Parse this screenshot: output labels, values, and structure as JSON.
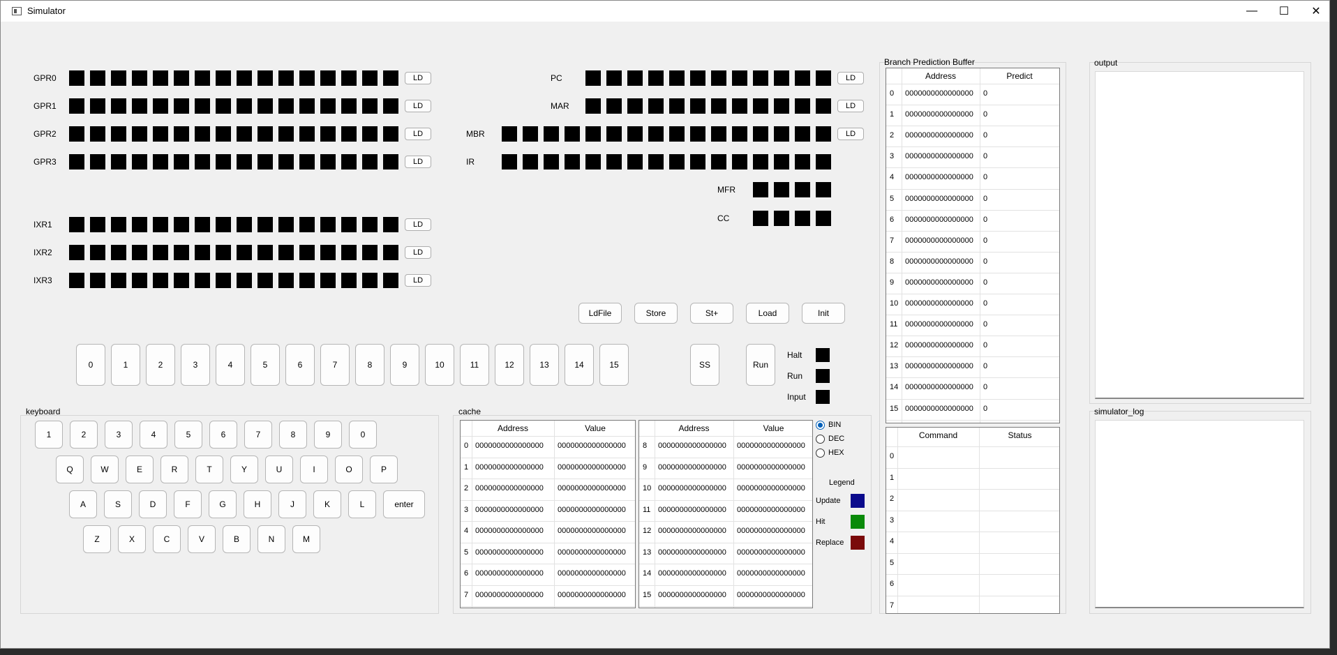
{
  "window": {
    "title": "Simulator",
    "minimize_glyph": "—",
    "maximize_glyph": "☐",
    "close_glyph": "✕",
    "icon": "app-window-icon"
  },
  "registers": {
    "gpr0": "GPR0",
    "gpr1": "GPR1",
    "gpr2": "GPR2",
    "gpr3": "GPR3",
    "ixr1": "IXR1",
    "ixr2": "IXR2",
    "ixr3": "IXR3",
    "pc": "PC",
    "mar": "MAR",
    "mbr": "MBR",
    "ir": "IR",
    "mfr": "MFR",
    "cc": "CC",
    "ld_label": "LD"
  },
  "controls": {
    "ldfile": "LdFile",
    "store": "Store",
    "st_plus": "St+",
    "load": "Load",
    "init": "Init",
    "switches": [
      "0",
      "1",
      "2",
      "3",
      "4",
      "5",
      "6",
      "7",
      "8",
      "9",
      "10",
      "11",
      "12",
      "13",
      "14",
      "15"
    ],
    "ss": "SS",
    "run": "Run",
    "halt_label": "Halt",
    "run_label": "Run",
    "input_label": "Input"
  },
  "keyboard": {
    "title": "keyboard",
    "row1": [
      "1",
      "2",
      "3",
      "4",
      "5",
      "6",
      "7",
      "8",
      "9",
      "0"
    ],
    "row2": [
      "Q",
      "W",
      "E",
      "R",
      "T",
      "Y",
      "U",
      "I",
      "O",
      "P"
    ],
    "row3": [
      "A",
      "S",
      "D",
      "F",
      "G",
      "H",
      "J",
      "K",
      "L",
      "enter"
    ],
    "row4": [
      "Z",
      "X",
      "C",
      "V",
      "B",
      "N",
      "M"
    ]
  },
  "cache": {
    "title": "cache",
    "col_address": "Address",
    "col_value": "Value",
    "left_rows": [
      {
        "i": "0",
        "a": "0000000000000000",
        "v": "0000000000000000"
      },
      {
        "i": "1",
        "a": "0000000000000000",
        "v": "0000000000000000"
      },
      {
        "i": "2",
        "a": "0000000000000000",
        "v": "0000000000000000"
      },
      {
        "i": "3",
        "a": "0000000000000000",
        "v": "0000000000000000"
      },
      {
        "i": "4",
        "a": "0000000000000000",
        "v": "0000000000000000"
      },
      {
        "i": "5",
        "a": "0000000000000000",
        "v": "0000000000000000"
      },
      {
        "i": "6",
        "a": "0000000000000000",
        "v": "0000000000000000"
      },
      {
        "i": "7",
        "a": "0000000000000000",
        "v": "0000000000000000"
      }
    ],
    "right_rows": [
      {
        "i": "8",
        "a": "0000000000000000",
        "v": "0000000000000000"
      },
      {
        "i": "9",
        "a": "0000000000000000",
        "v": "0000000000000000"
      },
      {
        "i": "10",
        "a": "0000000000000000",
        "v": "0000000000000000"
      },
      {
        "i": "11",
        "a": "0000000000000000",
        "v": "0000000000000000"
      },
      {
        "i": "12",
        "a": "0000000000000000",
        "v": "0000000000000000"
      },
      {
        "i": "13",
        "a": "0000000000000000",
        "v": "0000000000000000"
      },
      {
        "i": "14",
        "a": "0000000000000000",
        "v": "0000000000000000"
      },
      {
        "i": "15",
        "a": "0000000000000000",
        "v": "0000000000000000"
      }
    ],
    "radix": {
      "bin": "BIN",
      "dec": "DEC",
      "hex": "HEX",
      "selected": "BIN"
    },
    "legend": {
      "title": "Legend",
      "update": "Update",
      "hit": "Hit",
      "replace": "Replace",
      "update_color": "#0a0a8c",
      "hit_color": "#0a8a0a",
      "replace_color": "#7a0a0a"
    }
  },
  "bpb": {
    "title": "Branch Prediction Buffer",
    "col_address": "Address",
    "col_predict": "Predict",
    "rows": [
      {
        "i": "0",
        "a": "0000000000000000",
        "p": "0"
      },
      {
        "i": "1",
        "a": "0000000000000000",
        "p": "0"
      },
      {
        "i": "2",
        "a": "0000000000000000",
        "p": "0"
      },
      {
        "i": "3",
        "a": "0000000000000000",
        "p": "0"
      },
      {
        "i": "4",
        "a": "0000000000000000",
        "p": "0"
      },
      {
        "i": "5",
        "a": "0000000000000000",
        "p": "0"
      },
      {
        "i": "6",
        "a": "0000000000000000",
        "p": "0"
      },
      {
        "i": "7",
        "a": "0000000000000000",
        "p": "0"
      },
      {
        "i": "8",
        "a": "0000000000000000",
        "p": "0"
      },
      {
        "i": "9",
        "a": "0000000000000000",
        "p": "0"
      },
      {
        "i": "10",
        "a": "0000000000000000",
        "p": "0"
      },
      {
        "i": "11",
        "a": "0000000000000000",
        "p": "0"
      },
      {
        "i": "12",
        "a": "0000000000000000",
        "p": "0"
      },
      {
        "i": "13",
        "a": "0000000000000000",
        "p": "0"
      },
      {
        "i": "14",
        "a": "0000000000000000",
        "p": "0"
      },
      {
        "i": "15",
        "a": "0000000000000000",
        "p": "0"
      }
    ]
  },
  "commands": {
    "col_command": "Command",
    "col_status": "Status",
    "rows": [
      "0",
      "1",
      "2",
      "3",
      "4",
      "5",
      "6",
      "7"
    ]
  },
  "output": {
    "title": "output",
    "text": ""
  },
  "simulator_log": {
    "title": "simulator_log",
    "text": ""
  }
}
